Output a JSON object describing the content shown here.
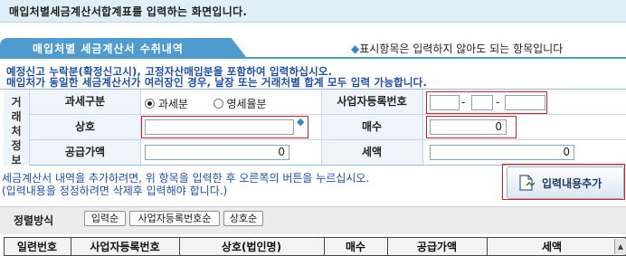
{
  "page_title": "매입처별세금계산서합계표를 입력하는 화면입니다.",
  "section_tab": "매입처별 세금계산서 수취내역",
  "optional_note": "표시항목은 입력하지 않아도 되는 항목입니다",
  "warnings": [
    "예정신고 누락분(확정신고시), 고정자산매입분을 포함하여 입력하십시오.",
    "매입처가 동일한 세금계산서가 여러장인 경우, 날장 또는 거래처별 합계 모두 입력 가능합니다."
  ],
  "side_label": [
    "거",
    "래",
    "처",
    "정",
    "보"
  ],
  "form": {
    "tax_type_label": "과세구분",
    "tax_type_options": [
      "과세분",
      "영세율분"
    ],
    "tax_type_selected": "과세분",
    "biz_no_label": "사업자등록번호",
    "biz_no_sep": "-",
    "name_label": "상호",
    "name_value": "",
    "count_label": "매수",
    "count_value": "0",
    "supply_label": "공급가액",
    "supply_value": "0",
    "tax_label": "세액",
    "tax_value": "0"
  },
  "info_lines": [
    "세금계산서 내역을 추가하려면, 위 항목을 입력한 후 오른쪽의 버튼을 누르십시오.",
    "(입력내용을 정정하려면 삭제후 입력해야 합니다.)"
  ],
  "add_button": "입력내용추가",
  "sort": {
    "label": "정렬방식",
    "options": [
      "입력순",
      "사업자등록번호순",
      "상호순"
    ]
  },
  "table_headers": [
    "일련번호",
    "사업자등록번호",
    "상호(법인명)",
    "매수",
    "공급가액",
    "세액"
  ]
}
